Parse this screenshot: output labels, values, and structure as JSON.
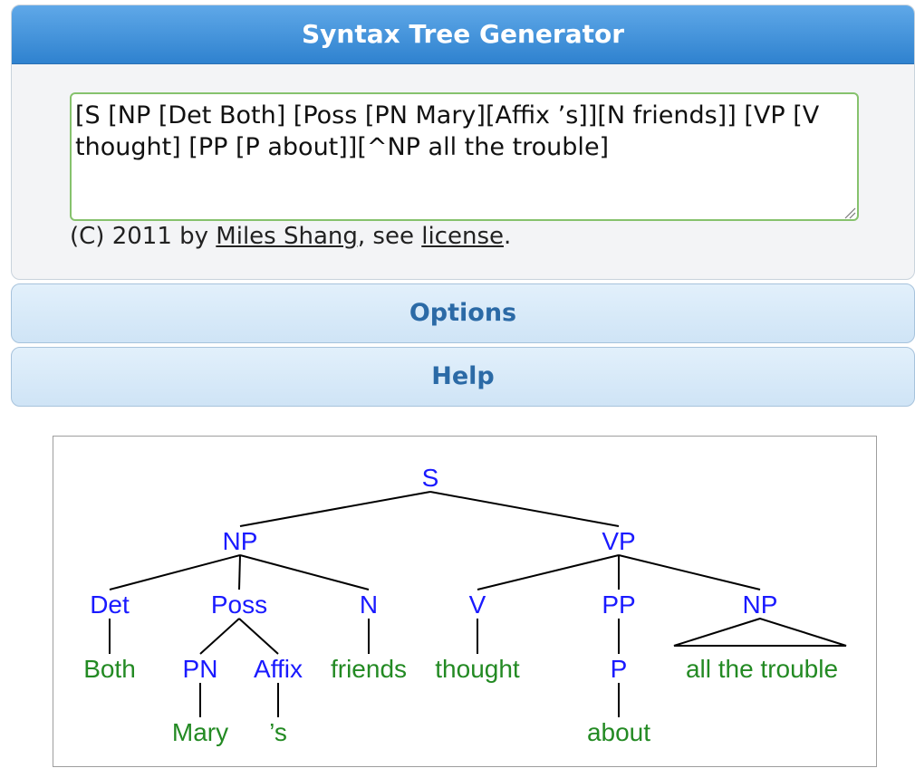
{
  "app": {
    "title": "Syntax Tree Generator"
  },
  "editor": {
    "value": "[S [NP [Det Both] [Poss [PN Mary][Affix ’s]][N friends]] [VP [V thought] [PP [P about]][^NP all the trouble]"
  },
  "footer": {
    "prefix": "(C) 2011 by ",
    "author": "Miles Shang",
    "middle": ", see ",
    "license": "license",
    "suffix": "."
  },
  "sections": {
    "options": "Options",
    "help": "Help"
  },
  "colors": {
    "header": "#2f82cf",
    "input_border": "#86c26d",
    "accordion_text": "#2b6aa6",
    "node_label": "#1a1aff",
    "leaf_label": "#238a23"
  },
  "tree": {
    "nodes": [
      {
        "id": "S",
        "label": "S",
        "type": "node"
      },
      {
        "id": "NP1",
        "label": "NP",
        "type": "node",
        "parent": "S"
      },
      {
        "id": "VP",
        "label": "VP",
        "type": "node",
        "parent": "S"
      },
      {
        "id": "Det",
        "label": "Det",
        "type": "node",
        "parent": "NP1"
      },
      {
        "id": "Poss",
        "label": "Poss",
        "type": "node",
        "parent": "NP1"
      },
      {
        "id": "N",
        "label": "N",
        "type": "node",
        "parent": "NP1"
      },
      {
        "id": "V",
        "label": "V",
        "type": "node",
        "parent": "VP"
      },
      {
        "id": "PP",
        "label": "PP",
        "type": "node",
        "parent": "VP"
      },
      {
        "id": "NP2",
        "label": "NP",
        "type": "node",
        "parent": "VP",
        "triangle": true
      },
      {
        "id": "Both",
        "label": "Both",
        "type": "leaf",
        "parent": "Det"
      },
      {
        "id": "PN",
        "label": "PN",
        "type": "node",
        "parent": "Poss"
      },
      {
        "id": "Affix",
        "label": "Affix",
        "type": "node",
        "parent": "Poss"
      },
      {
        "id": "friends",
        "label": "friends",
        "type": "leaf",
        "parent": "N"
      },
      {
        "id": "thought",
        "label": "thought",
        "type": "leaf",
        "parent": "V"
      },
      {
        "id": "P",
        "label": "P",
        "type": "node",
        "parent": "PP"
      },
      {
        "id": "trouble",
        "label": "all the trouble",
        "type": "leaf",
        "parent": "NP2"
      },
      {
        "id": "Mary",
        "label": "Mary",
        "type": "leaf",
        "parent": "PN"
      },
      {
        "id": "s",
        "label": "’s",
        "type": "leaf",
        "parent": "Affix"
      },
      {
        "id": "about",
        "label": "about",
        "type": "leaf",
        "parent": "P"
      }
    ]
  }
}
